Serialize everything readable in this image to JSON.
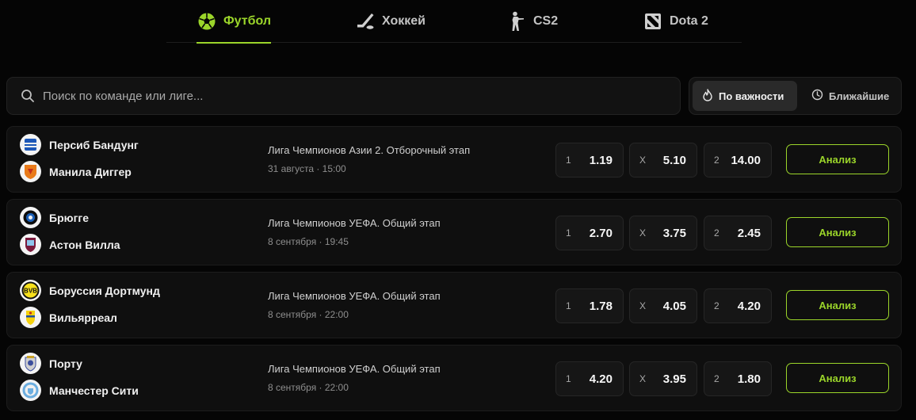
{
  "tabs": [
    {
      "label": "Футбол",
      "icon": "soccer-ball-icon",
      "active": true
    },
    {
      "label": "Хоккей",
      "icon": "hockey-stick-icon",
      "active": false
    },
    {
      "label": "CS2",
      "icon": "cs2-soldier-icon",
      "active": false
    },
    {
      "label": "Dota 2",
      "icon": "dota2-logo-icon",
      "active": false
    }
  ],
  "search": {
    "placeholder": "Поиск по команде или лиге...",
    "value": ""
  },
  "sort": {
    "options": [
      {
        "label": "По важности",
        "icon": "flame-icon",
        "active": true
      },
      {
        "label": "Ближайшие",
        "icon": "clock-icon",
        "active": false
      }
    ]
  },
  "colors": {
    "accent": "#9bd52a",
    "background": "#050505",
    "card": "#0f0f0f"
  },
  "matches": [
    {
      "home": "Персиб Бандунг",
      "away": "Манила Диггер",
      "league": "Лига Чемпионов Азии 2. Отборочный этап",
      "date": "31 августа · 15:00",
      "odds": [
        {
          "label": "1",
          "value": "1.19"
        },
        {
          "label": "X",
          "value": "5.10"
        },
        {
          "label": "2",
          "value": "14.00"
        }
      ],
      "action": "Анализ"
    },
    {
      "home": "Брюгге",
      "away": "Астон Вилла",
      "league": "Лига Чемпионов УЕФА. Общий этап",
      "date": "8 сентября · 19:45",
      "odds": [
        {
          "label": "1",
          "value": "2.70"
        },
        {
          "label": "X",
          "value": "3.75"
        },
        {
          "label": "2",
          "value": "2.45"
        }
      ],
      "action": "Анализ"
    },
    {
      "home": "Боруссия Дортмунд",
      "away": "Вильярреал",
      "league": "Лига Чемпионов УЕФА. Общий этап",
      "date": "8 сентября · 22:00",
      "odds": [
        {
          "label": "1",
          "value": "1.78"
        },
        {
          "label": "X",
          "value": "4.05"
        },
        {
          "label": "2",
          "value": "4.20"
        }
      ],
      "action": "Анализ"
    },
    {
      "home": "Порту",
      "away": "Манчестер Сити",
      "league": "Лига Чемпионов УЕФА. Общий этап",
      "date": "8 сентября · 22:00",
      "odds": [
        {
          "label": "1",
          "value": "4.20"
        },
        {
          "label": "X",
          "value": "3.95"
        },
        {
          "label": "2",
          "value": "1.80"
        }
      ],
      "action": "Анализ"
    }
  ]
}
